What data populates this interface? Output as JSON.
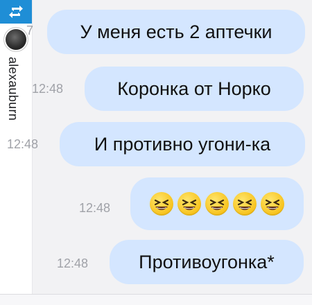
{
  "sidebar": {
    "repost_icon": "repost-icon",
    "username": "alexauburn",
    "edge_time_fragment": "7"
  },
  "messages": [
    {
      "text": "У меня есть 2 аптечки",
      "time": ""
    },
    {
      "text": "Коронка от Норко",
      "time": "12:48"
    },
    {
      "text": "И противно угони-ка",
      "time": "12:48"
    },
    {
      "emoji": [
        "laughing-face-icon",
        "laughing-face-icon",
        "laughing-face-icon",
        "laughing-face-icon",
        "laughing-face-icon"
      ],
      "time": "12:48"
    },
    {
      "text": "Противоугонка*",
      "time": "12:48"
    }
  ],
  "colors": {
    "bubble": "#d4e6ff",
    "repost_badge": "#1f8ed6",
    "timestamp": "#a0a2a8"
  }
}
